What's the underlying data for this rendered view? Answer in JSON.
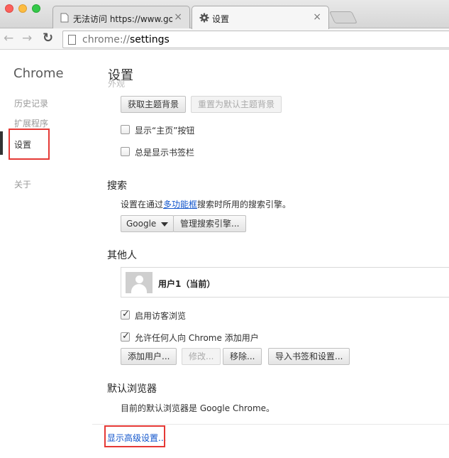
{
  "browser": {
    "tabs": [
      {
        "title": "无法访问 https://www.google.com",
        "close": "×",
        "active": false
      },
      {
        "title": "设置",
        "close": "×",
        "active": true
      }
    ],
    "url_scheme": "chrome://",
    "url_path": "settings"
  },
  "sidebar": {
    "brand": "Chrome",
    "items": [
      {
        "label": "历史记录"
      },
      {
        "label": "扩展程序"
      },
      {
        "label": "设置"
      },
      {
        "label": "关于"
      }
    ],
    "selected": "设置"
  },
  "main": {
    "title": "设置",
    "appearance_faded": "外观",
    "appearance": {
      "get_themes": "获取主题背景",
      "reset_theme": "重置为默认主题背景",
      "show_home": "显示“主页”按钮",
      "show_bookmarks": "总是显示书签栏"
    },
    "search": {
      "heading": "搜索",
      "desc_prefix": "设置在通过",
      "desc_link": "多功能框",
      "desc_suffix": "搜索时所用的搜索引擎。",
      "engine": "Google",
      "manage": "管理搜索引擎..."
    },
    "people": {
      "heading": "其他人",
      "user": "用户1（当前）",
      "guest": "启用访客浏览",
      "guest_checked": true,
      "anyone_add": "允许任何人向 Chrome 添加用户",
      "anyone_add_checked": true,
      "add_user": "添加用户...",
      "edit": "修改...",
      "remove": "移除...",
      "import": "导入书签和设置..."
    },
    "default_browser": {
      "heading": "默认浏览器",
      "desc": "目前的默认浏览器是 Google Chrome。"
    },
    "advanced_link": "显示高级设置..."
  },
  "colors": {
    "highlight": "#e53935",
    "link": "#1155cc"
  }
}
